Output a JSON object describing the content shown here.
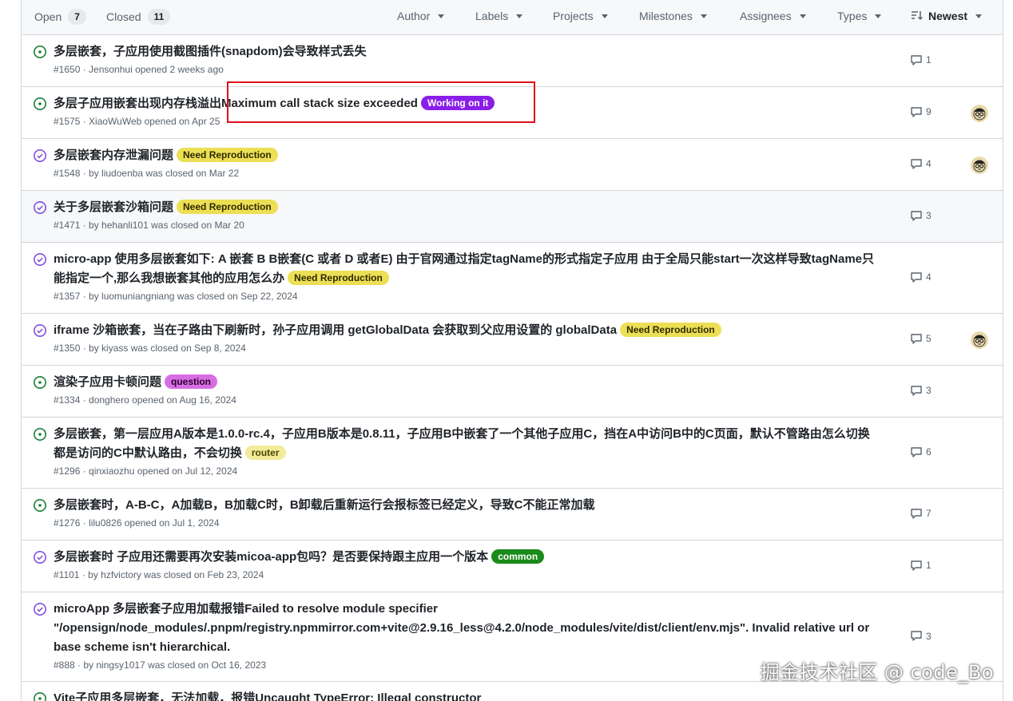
{
  "header": {
    "open_label": "Open",
    "open_count": "7",
    "closed_label": "Closed",
    "closed_count": "11",
    "filters": [
      "Author",
      "Labels",
      "Projects",
      "Milestones",
      "Assignees",
      "Types"
    ],
    "sort_label": "Newest"
  },
  "colors": {
    "open_icon": "#1a7f37",
    "closed_icon": "#8250df",
    "highlight": "#e0101a"
  },
  "labels": {
    "working_on_it": {
      "text": "Working on it",
      "bg": "#8a1de8",
      "fg": "#ffffff"
    },
    "need_reproduction": {
      "text": "Need Reproduction",
      "bg": "#ecdf55",
      "fg": "#2e2a00"
    },
    "question": {
      "text": "question",
      "bg": "#d76de3",
      "fg": "#2b0030"
    },
    "router": {
      "text": "router",
      "bg": "#f2ec9a",
      "fg": "#4a4400"
    },
    "common": {
      "text": "common",
      "bg": "#1a8a1a",
      "fg": "#ffffff"
    }
  },
  "issues": [
    {
      "state": "open",
      "title": "多层嵌套，子应用使用截图插件(snapdom)会导致样式丢失",
      "label": null,
      "meta": "#1650 · Jensonhui opened 2 weeks ago",
      "comments": "1",
      "avatar": false
    },
    {
      "state": "open",
      "title": "多层子应用嵌套出现内存栈溢出Maximum call stack size exceeded",
      "label": "working_on_it",
      "meta": "#1575 · XiaoWuWeb opened on Apr 25",
      "comments": "9",
      "avatar": true
    },
    {
      "state": "closed",
      "title": "多层嵌套内存泄漏问题",
      "label": "need_reproduction",
      "meta": "#1548 · by liudoenba was closed on Mar 22",
      "comments": "4",
      "avatar": true
    },
    {
      "state": "closed",
      "title": "关于多层嵌套沙箱问题",
      "label": "need_reproduction",
      "meta": "#1471 · by hehanli101 was closed on Mar 20",
      "comments": "3",
      "avatar": false
    },
    {
      "state": "closed",
      "title": "micro-app 使用多层嵌套如下: A 嵌套 B B嵌套(C 或者 D 或者E) 由于官网通过指定tagName的形式指定子应用 由于全局只能start一次这样导致tagName只能指定一个,那么我想嵌套其他的应用怎么办",
      "label": "need_reproduction",
      "meta": "#1357 · by luomuniangniang was closed on Sep 22, 2024",
      "comments": "4",
      "avatar": false
    },
    {
      "state": "closed",
      "title": "iframe 沙箱嵌套，当在子路由下刷新时，孙子应用调用 getGlobalData 会获取到父应用设置的 globalData",
      "label": "need_reproduction",
      "meta": "#1350 · by kiyass was closed on Sep 8, 2024",
      "comments": "5",
      "avatar": true
    },
    {
      "state": "open",
      "title": "渲染子应用卡顿问题",
      "label": "question",
      "meta": "#1334 · donghero opened on Aug 16, 2024",
      "comments": "3",
      "avatar": false
    },
    {
      "state": "open",
      "title": "多层嵌套，第一层应用A版本是1.0.0-rc.4，子应用B版本是0.8.11，子应用B中嵌套了一个其他子应用C，挡在A中访问B中的C页面，默认不管路由怎么切换都是访问的C中默认路由，不会切换",
      "label": "router",
      "meta": "#1296 · qinxiaozhu opened on Jul 12, 2024",
      "comments": "6",
      "avatar": false
    },
    {
      "state": "open",
      "title": "多层嵌套时，A-B-C，A加载B，B加载C时，B卸载后重新运行会报标签已经定义，导致C不能正常加载",
      "label": null,
      "meta": "#1276 · lilu0826 opened on Jul 1, 2024",
      "comments": "7",
      "avatar": false
    },
    {
      "state": "closed",
      "title": "多层嵌套时 子应用还需要再次安装micoa-app包吗？是否要保持跟主应用一个版本",
      "label": "common",
      "meta": "#1101 · by hzfvictory was closed on Feb 23, 2024",
      "comments": "1",
      "avatar": false
    },
    {
      "state": "closed",
      "title": "microApp 多层嵌套子应用加载报错Failed to resolve module specifier \"/opensign/node_modules/.pnpm/registry.npmmirror.com+vite@2.9.16_less@4.2.0/node_modules/vite/dist/client/env.mjs\". Invalid relative url or base scheme isn't hierarchical.",
      "label": null,
      "meta": "#888 · by ningsy1017 was closed on Oct 16, 2023",
      "comments": "3",
      "avatar": false
    },
    {
      "state": "open",
      "title": "Vite子应用多层嵌套，无法加载，报错Uncaught TypeError: Illegal constructor",
      "label": null,
      "meta": "",
      "comments": "",
      "avatar": false
    }
  ],
  "watermark": "掘金技术社区 @ code_Bo"
}
